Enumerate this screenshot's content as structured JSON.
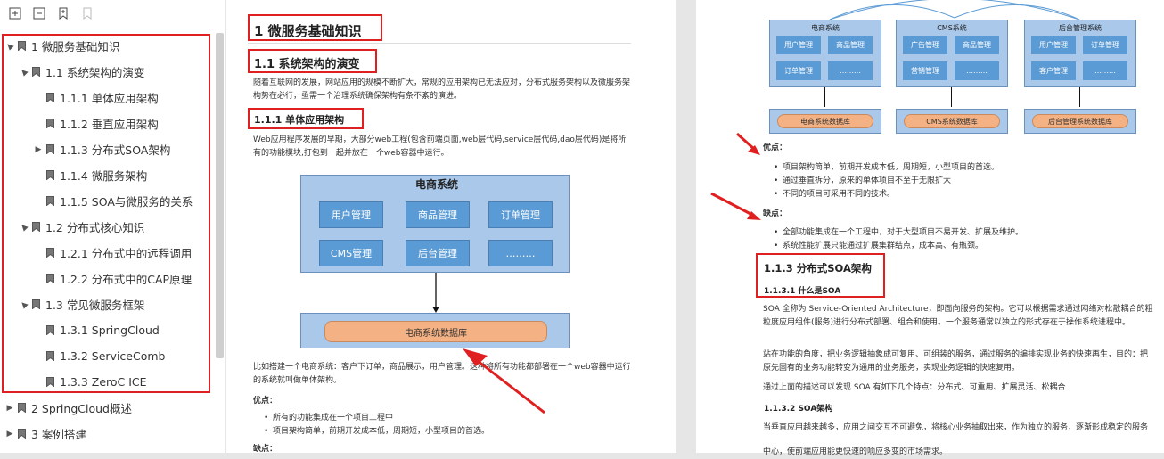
{
  "toolbar": {
    "icons": [
      "expand-all-icon",
      "collapse-all-icon",
      "add-bookmark-icon",
      "bookmark-disabled-icon"
    ]
  },
  "tree": [
    {
      "label": "1 微服务基础知识",
      "level": 0,
      "arrow": "▲"
    },
    {
      "label": "1.1 系统架构的演变",
      "level": 1,
      "arrow": "▲"
    },
    {
      "label": "1.1.1 单体应用架构",
      "level": 2,
      "arrow": ""
    },
    {
      "label": "1.1.2 垂直应用架构",
      "level": 2,
      "arrow": ""
    },
    {
      "label": "1.1.3 分布式SOA架构",
      "level": 2,
      "arrow": "▶"
    },
    {
      "label": "1.1.4 微服务架构",
      "level": 2,
      "arrow": ""
    },
    {
      "label": "1.1.5 SOA与微服务的关系",
      "level": 2,
      "arrow": ""
    },
    {
      "label": "1.2 分布式核心知识",
      "level": 1,
      "arrow": "▲"
    },
    {
      "label": "1.2.1  分布式中的远程调用",
      "level": 2,
      "arrow": ""
    },
    {
      "label": "1.2.2  分布式中的CAP原理",
      "level": 2,
      "arrow": ""
    },
    {
      "label": "1.3 常见微服务框架",
      "level": 1,
      "arrow": "▲"
    },
    {
      "label": "1.3.1 SpringCloud",
      "level": 2,
      "arrow": ""
    },
    {
      "label": "1.3.2 ServiceComb",
      "level": 2,
      "arrow": ""
    },
    {
      "label": "1.3.3 ZeroC ICE",
      "level": 2,
      "arrow": ""
    },
    {
      "label": "2 SpringCloud概述",
      "level": 0,
      "arrow": "▶"
    },
    {
      "label": "3 案例搭建",
      "level": 0,
      "arrow": "▶"
    }
  ],
  "page1": {
    "h1": "1 微服务基础知识",
    "h2": "1.1 系统架构的演变",
    "intro": "随着互联网的发展，网站应用的规模不断扩大，常规的应用架构已无法应对，分布式服务架构以及微服务架构势在必行，亟需一个治理系统确保架构有条不紊的演进。",
    "h3": "1.1.1 单体应用架构",
    "p1": "Web应用程序发展的早期，大部分web工程(包含前端页面,web层代码,service层代码,dao层代码)是将所有的功能模块,打包到一起并放在一个web容器中运行。",
    "diagram": {
      "title": "电商系统",
      "modules": [
        "用户管理",
        "商品管理",
        "订单管理",
        "CMS管理",
        "后台管理",
        "………"
      ],
      "db": "电商系统数据库"
    },
    "p2": "比如搭建一个电商系统：客户下订单，商品展示，用户管理。这种将所有功能都部署在一个web容器中运行的系统就叫做单体架构。",
    "pros_label": "优点：",
    "pros": [
      "所有的功能集成在一个项目工程中",
      "项目架构简单，前期开发成本低，周期短，小型项目的首选。"
    ],
    "cons_label": "缺点："
  },
  "page2": {
    "systems": [
      {
        "title": "电商系统",
        "modules": [
          "用户管理",
          "商品管理",
          "订单管理",
          "………"
        ],
        "db": "电商系统数据库"
      },
      {
        "title": "CMS系统",
        "modules": [
          "广告管理",
          "商品管理",
          "营销管理",
          "………"
        ],
        "db": "CMS系统数据库"
      },
      {
        "title": "后台管理系统",
        "modules": [
          "用户管理",
          "订单管理",
          "客户管理",
          "………"
        ],
        "db": "后台管理系统数据库"
      }
    ],
    "pros_label": "优点：",
    "pros": [
      "项目架构简单，前期开发成本低，周期短，小型项目的首选。",
      "通过垂直拆分，原来的单体项目不至于无限扩大",
      "不同的项目可采用不同的技术。"
    ],
    "cons_label": "缺点：",
    "cons": [
      "全部功能集成在一个工程中，对于大型项目不易开发、扩展及维护。",
      "系统性能扩展只能通过扩展集群结点，成本高、有瓶颈。"
    ],
    "h3": "1.1.3 分布式SOA架构",
    "h4a": "1.1.3.1 什么是SOA",
    "pa": "SOA 全称为 Service-Oriented Architecture，即面向服务的架构。它可以根据需求通过网络对松散耦合的粗粒度应用组件(服务)进行分布式部署、组合和使用。一个服务通常以独立的形式存在于操作系统进程中。",
    "pb": "站在功能的角度，把业务逻辑抽象成可复用、可组装的服务，通过服务的编排实现业务的快速再生，目的：把原先固有的业务功能转变为通用的业务服务，实现业务逻辑的快速复用。",
    "pc": "通过上面的描述可以发现 SOA 有如下几个特点：分布式、可重用、扩展灵活、松耦合",
    "h4b": "1.1.3.2 SOA架构",
    "pd": "当垂直应用越来越多，应用之间交互不可避免，将核心业务抽取出来，作为独立的服务，逐渐形成稳定的服务",
    "pe": "中心，使前端应用能更快速的响应多变的市场需求。"
  },
  "colors": {
    "highlight": "#e02020",
    "module": "#5b9bd5",
    "system_bg": "#a9c8ea",
    "db": "#f4b183"
  }
}
